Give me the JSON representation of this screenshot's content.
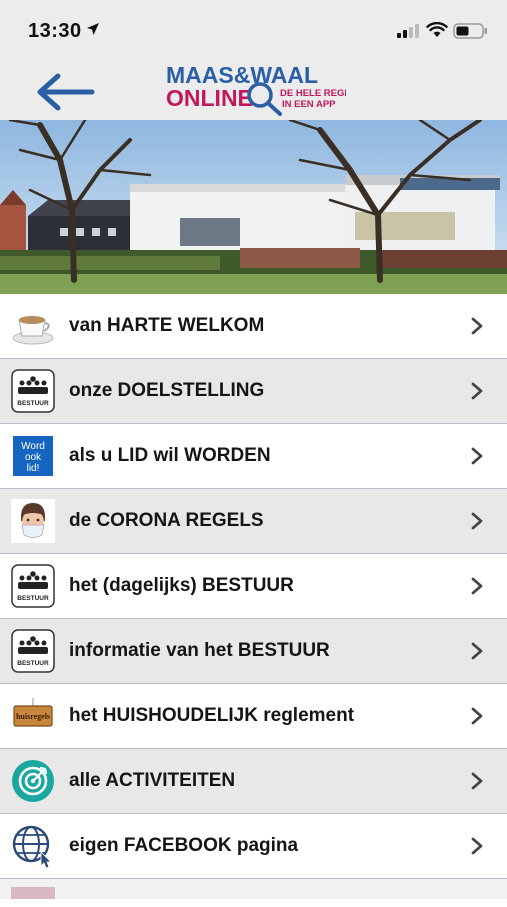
{
  "status_bar": {
    "time": "13:30"
  },
  "header": {
    "back_icon": "arrow-left-icon",
    "logo_line1": "MAAS&WAAL",
    "logo_line2": "ONLINE",
    "logo_tagline1": "DE HELE REGIO",
    "logo_tagline2": "IN EEN APP"
  },
  "menu": {
    "items": [
      {
        "label": "van HARTE WELKOM",
        "icon": "coffee-cup-icon"
      },
      {
        "label": "onze DOELSTELLING",
        "icon": "bestuur-icon",
        "icon_text": "BESTUUR"
      },
      {
        "label": "als u LID wil WORDEN",
        "icon": "word-ook-lid-icon",
        "icon_text": "Word ook lid!"
      },
      {
        "label": "de CORONA REGELS",
        "icon": "face-mask-icon"
      },
      {
        "label": "het (dagelijks) BESTUUR",
        "icon": "bestuur-icon",
        "icon_text": "BESTUUR"
      },
      {
        "label": "informatie van het BESTUUR",
        "icon": "bestuur-icon",
        "icon_text": "BESTUUR"
      },
      {
        "label": "het HUISHOUDELIJK reglement",
        "icon": "huisregels-sign-icon",
        "icon_text": "huisregels"
      },
      {
        "label": "alle ACTIVITEITEN",
        "icon": "target-icon"
      },
      {
        "label": "eigen FACEBOOK pagina",
        "icon": "globe-cursor-icon"
      }
    ]
  },
  "colors": {
    "logo_blue": "#2a5fa8",
    "logo_pink": "#c2185b",
    "row_alt": "#e8e8e8",
    "divider": "#b9b9d2",
    "target_teal": "#1aa7a0"
  }
}
